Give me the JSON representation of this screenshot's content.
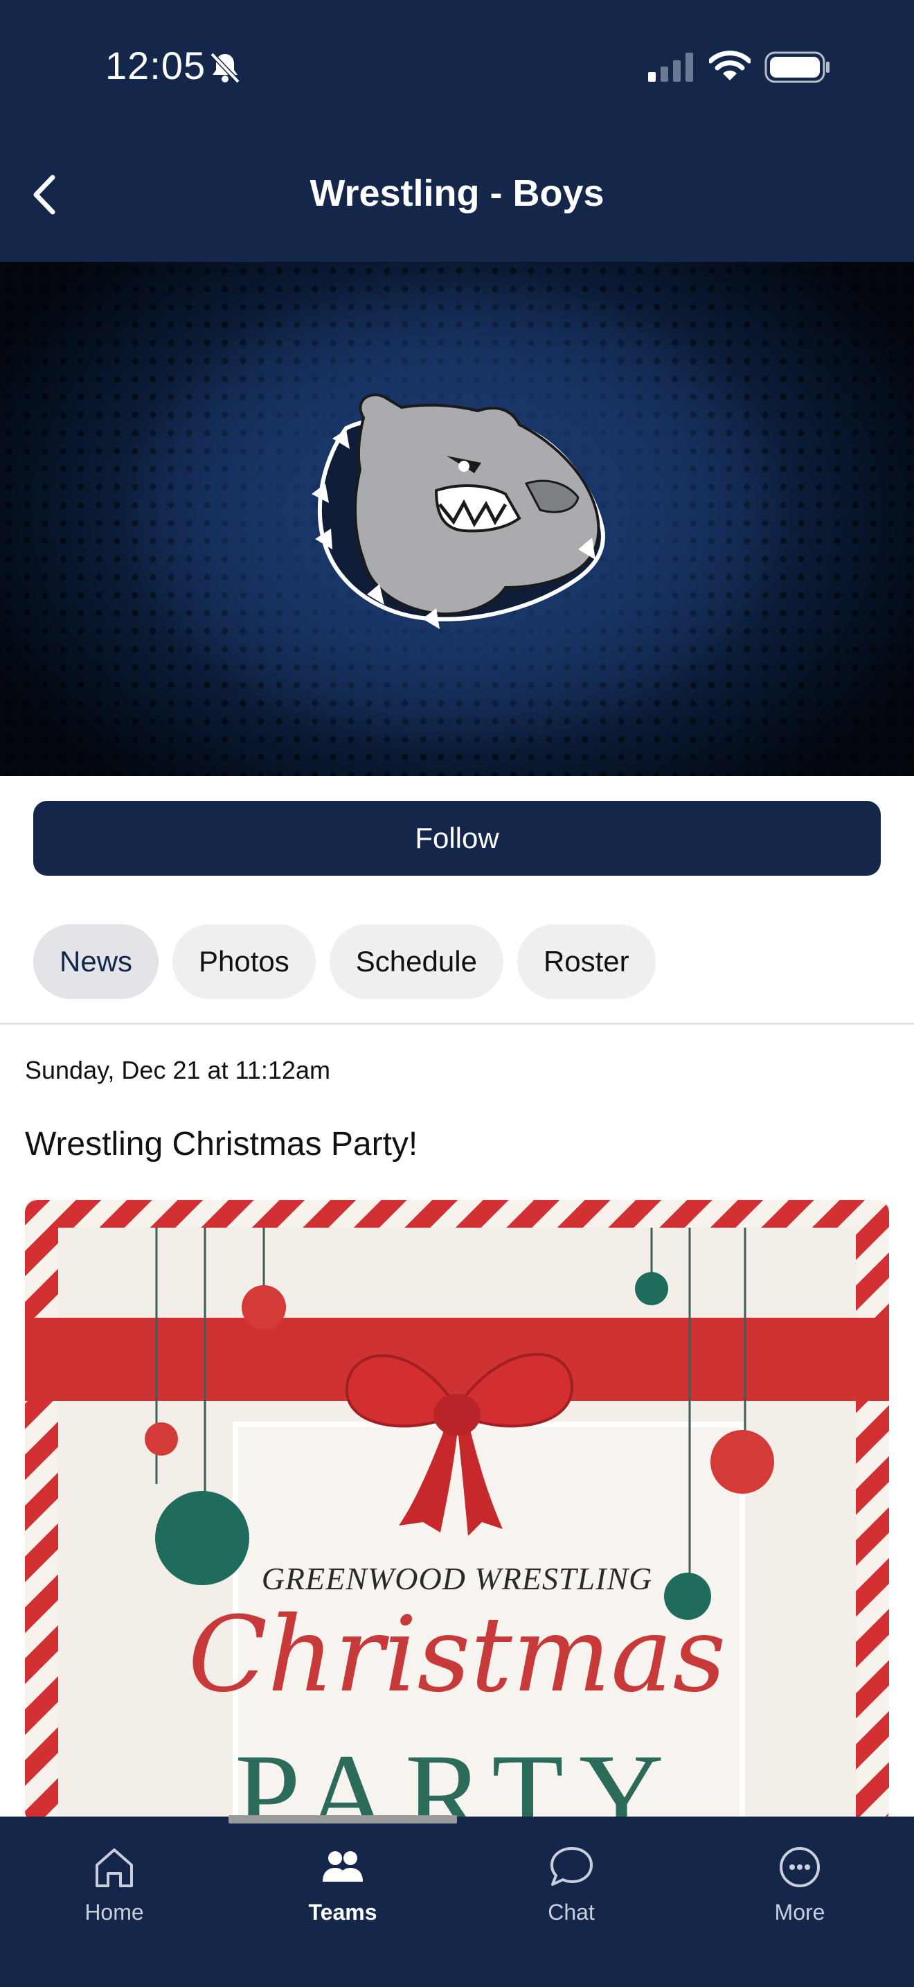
{
  "status_bar": {
    "time": "12:05",
    "icons": [
      "bell-slash-icon",
      "signal-icon",
      "wifi-icon",
      "battery-icon"
    ]
  },
  "header": {
    "title": "Wrestling - Boys",
    "back_icon": "chevron-left-icon"
  },
  "banner": {
    "logo": "bulldog-logo"
  },
  "follow_label": "Follow",
  "tabs": [
    {
      "label": "News",
      "active": true
    },
    {
      "label": "Photos"
    },
    {
      "label": "Schedule"
    },
    {
      "label": "Roster"
    }
  ],
  "post": {
    "date": "Sunday, Dec 21 at 11:12am",
    "title": "Wrestling Christmas Party!",
    "image": {
      "heading": "GREENWOOD WRESTLING",
      "script": "Christmas",
      "word": "PARTY"
    }
  },
  "bottom_nav": [
    {
      "label": "Home",
      "icon": "home-icon"
    },
    {
      "label": "Teams",
      "icon": "teams-icon",
      "active": true
    },
    {
      "label": "Chat",
      "icon": "chat-icon"
    },
    {
      "label": "More",
      "icon": "more-icon"
    }
  ],
  "colors": {
    "navy": "#14264a",
    "tab_bg": "#efefef",
    "active_tab_bg": "#e2e4e8",
    "ribbon_red": "#cf3233",
    "ornament_green": "#1f6b5c"
  }
}
